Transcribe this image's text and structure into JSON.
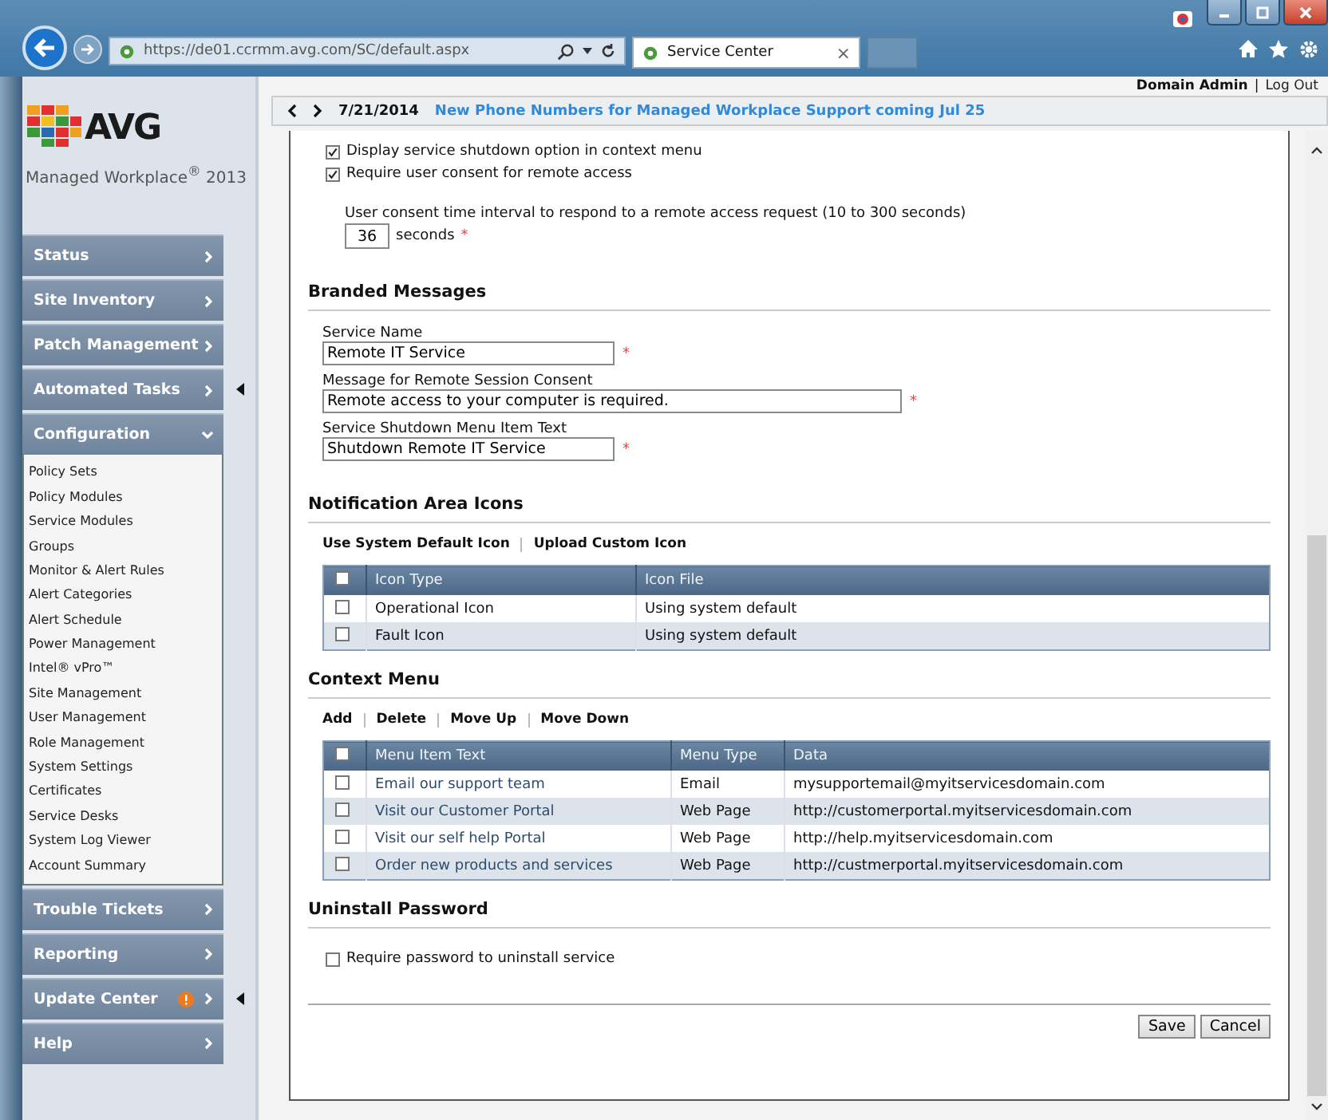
{
  "browser": {
    "address": "https://de01.ccrmm.avg.com/SC/default.aspx",
    "tab": {
      "title": "Service Center",
      "close": "×"
    }
  },
  "header": {
    "user": "Domain Admin",
    "separator": "|",
    "logout": "Log Out"
  },
  "news": {
    "date": "7/21/2014",
    "headline": "New Phone Numbers for Managed Workplace Support coming Jul 25"
  },
  "sidebar": {
    "logo_text": "AVG",
    "product": "Managed Workplace$^{®}$ 2013",
    "items": [
      {
        "label": "Status",
        "expanded": false,
        "alert": false
      },
      {
        "label": "Site Inventory",
        "expanded": false,
        "alert": false
      },
      {
        "label": "Patch Management",
        "expanded": false,
        "alert": false
      },
      {
        "label": "Automated Tasks",
        "expanded": false,
        "alert": false
      },
      {
        "label": "Configuration",
        "expanded": true,
        "alert": false,
        "children": [
          "Policy Sets",
          "Policy Modules",
          "Service Modules",
          "Groups",
          "Monitor & Alert Rules",
          "Alert Categories",
          "Alert Schedule",
          "Power Management",
          "Intel® vPro™",
          "Site Management",
          "User Management",
          "Role Management",
          "System Settings",
          "Certificates",
          "Service Desks",
          "System Log Viewer",
          "Account Summary"
        ]
      },
      {
        "label": "Trouble Tickets",
        "expanded": false,
        "alert": false
      },
      {
        "label": "Reporting",
        "expanded": false,
        "alert": false
      },
      {
        "label": "Update Center",
        "expanded": false,
        "alert": true
      },
      {
        "label": "Help",
        "expanded": false,
        "alert": false
      }
    ]
  },
  "remote_access": {
    "options": [
      {
        "label": "Display service shutdown option in context menu",
        "checked": true
      },
      {
        "label": "Require user consent for remote access",
        "checked": true
      }
    ],
    "interval": {
      "label": "User consent time interval to respond to a remote access request (10 to 300 seconds)",
      "value": "36",
      "unit": "seconds",
      "required_mark": "*"
    }
  },
  "branded_messages": {
    "title": "Branded Messages",
    "fields": [
      {
        "label": "Service Name",
        "value": "Remote IT Service",
        "required_mark": "*",
        "kind": "short"
      },
      {
        "label": "Message for Remote Session Consent",
        "value": "Remote access to your computer is required.",
        "required_mark": "*",
        "kind": "long"
      },
      {
        "label": "Service Shutdown Menu Item Text",
        "value": "Shutdown Remote IT Service",
        "required_mark": "*",
        "kind": "short"
      }
    ]
  },
  "notification_icons": {
    "title": "Notification Area Icons",
    "actions": [
      "Use System Default Icon",
      "Upload Custom Icon"
    ],
    "table": {
      "all_checked": false,
      "columns": [
        "Icon Type",
        "Icon File"
      ],
      "rows": [
        {
          "checked": false,
          "cells": [
            "Operational Icon",
            "Using system default"
          ]
        },
        {
          "checked": false,
          "cells": [
            "Fault Icon",
            "Using system default"
          ]
        }
      ]
    }
  },
  "context_menu": {
    "title": "Context Menu",
    "actions": [
      "Add",
      "Delete",
      "Move Up",
      "Move Down"
    ],
    "table": {
      "all_checked": false,
      "columns": [
        "Menu Item Text",
        "Menu Type",
        "Data"
      ],
      "rows": [
        {
          "checked": false,
          "cells": [
            "Email our support team",
            "Email",
            "mysupportemail@myitservicesdomain.com"
          ]
        },
        {
          "checked": false,
          "cells": [
            "Visit our Customer Portal",
            "Web Page",
            "http://customerportal.myitservicesdomain.com"
          ]
        },
        {
          "checked": false,
          "cells": [
            "Visit our self help Portal",
            "Web Page",
            "http://help.myitservicesdomain.com"
          ]
        },
        {
          "checked": false,
          "cells": [
            "Order new products and services",
            "Web Page",
            "http://custmerportal.myitservicesdomain.com"
          ]
        }
      ]
    }
  },
  "uninstall_password": {
    "title": "Uninstall Password",
    "option": {
      "label": "Require password to uninstall service",
      "checked": false
    }
  },
  "buttons": [
    "Save",
    "Cancel"
  ]
}
